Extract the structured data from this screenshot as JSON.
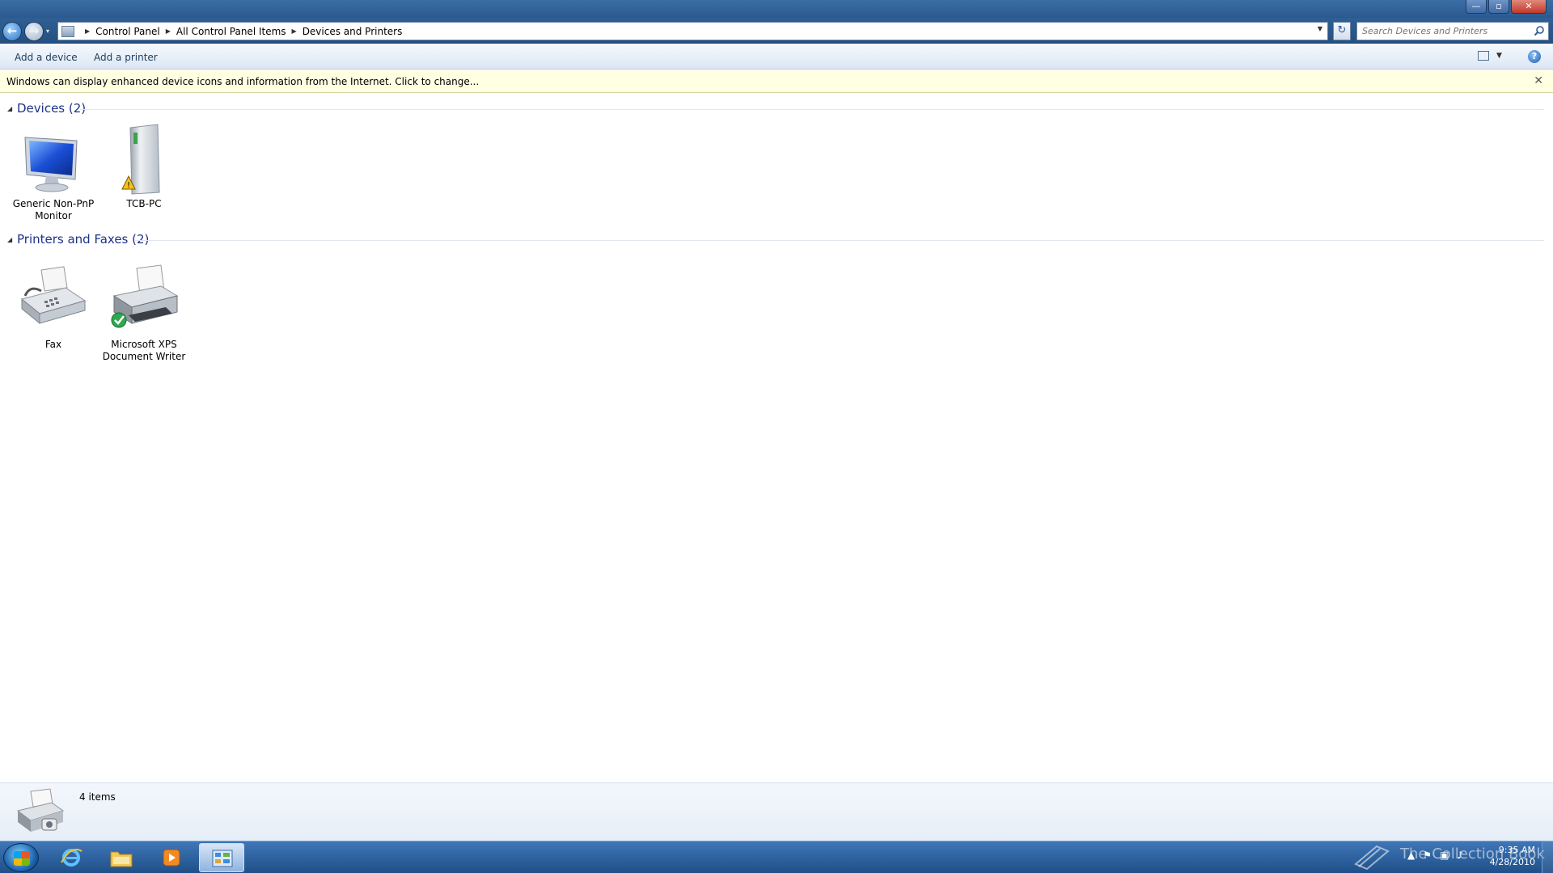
{
  "window": {
    "controls": {
      "minimize": "—",
      "maximize": "▫",
      "close": "✕"
    }
  },
  "nav": {
    "back_glyph": "←",
    "forward_glyph": "→",
    "history_glyph": "▾",
    "breadcrumbs": [
      "Control Panel",
      "All Control Panel Items",
      "Devices and Printers"
    ],
    "refresh_glyph": "↻",
    "search_placeholder": "Search Devices and Printers"
  },
  "commands": {
    "add_device": "Add a device",
    "add_printer": "Add a printer",
    "help": "?"
  },
  "infobar": {
    "text": "Windows can display enhanced device icons and information from the Internet. Click to change...",
    "close": "✕"
  },
  "groups": [
    {
      "title": "Devices (2)",
      "items": [
        {
          "label": "Generic Non-PnP Monitor",
          "icon": "monitor-icon",
          "badge": ""
        },
        {
          "label": "TCB-PC",
          "icon": "computer-tower-icon",
          "badge": "warning"
        }
      ]
    },
    {
      "title": "Printers and Faxes (2)",
      "items": [
        {
          "label": "Fax",
          "icon": "fax-icon",
          "badge": ""
        },
        {
          "label": "Microsoft XPS Document Writer",
          "icon": "printer-icon",
          "badge": "default-check"
        }
      ]
    }
  ],
  "details": {
    "count": "4 items"
  },
  "taskbar": {
    "items": [
      "internet-explorer-icon",
      "windows-explorer-icon",
      "media-player-icon",
      "control-panel-icon"
    ],
    "watermark": "The Collection Book",
    "time": "9:35 AM",
    "date": "4/28/2010"
  },
  "colors": {
    "group_title": "#1e3287",
    "infobar_bg": "#ffffe1",
    "taskbar": "#2b5e9c"
  }
}
